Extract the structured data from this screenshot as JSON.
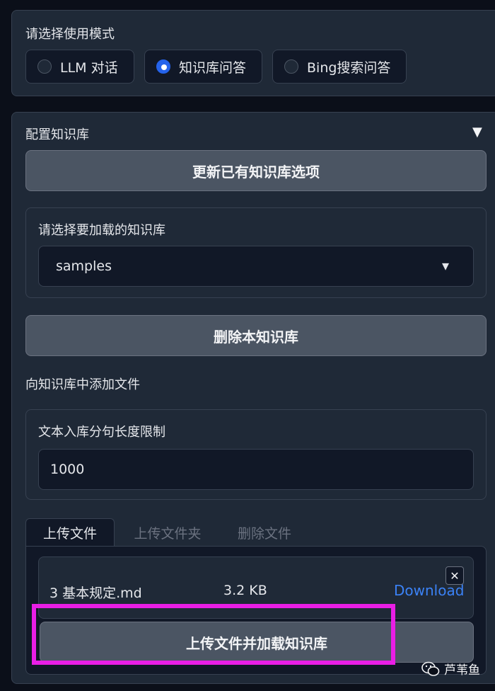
{
  "mode": {
    "label": "请选择使用模式",
    "options": [
      "LLM 对话",
      "知识库问答",
      "Bing搜索问答"
    ],
    "selected": "知识库问答"
  },
  "kb": {
    "section_title": "配置知识库",
    "toggle_icon": "▼",
    "refresh_button": "更新已有知识库选项",
    "select_label": "请选择要加载的知识库",
    "select_value": "samples",
    "dropdown_icon": "▾",
    "delete_button": "删除本知识库",
    "add_files_label": "向知识库中添加文件",
    "sentence_limit_label": "文本入库分句长度限制",
    "sentence_limit_value": "1000",
    "tabs": [
      "上传文件",
      "上传文件夹",
      "删除文件"
    ],
    "active_tab": "上传文件",
    "file": {
      "name": "3 基本规定.md",
      "size": "3.2 KB",
      "download_label": "Download",
      "remove_icon": "✕"
    },
    "upload_button": "上传文件并加载知识库"
  },
  "watermark": {
    "icon": "wechat-icon",
    "text": "芦苇鱼"
  },
  "colors": {
    "accent": "#2563eb",
    "highlight": "#e91ee6",
    "link": "#3b82f6"
  }
}
